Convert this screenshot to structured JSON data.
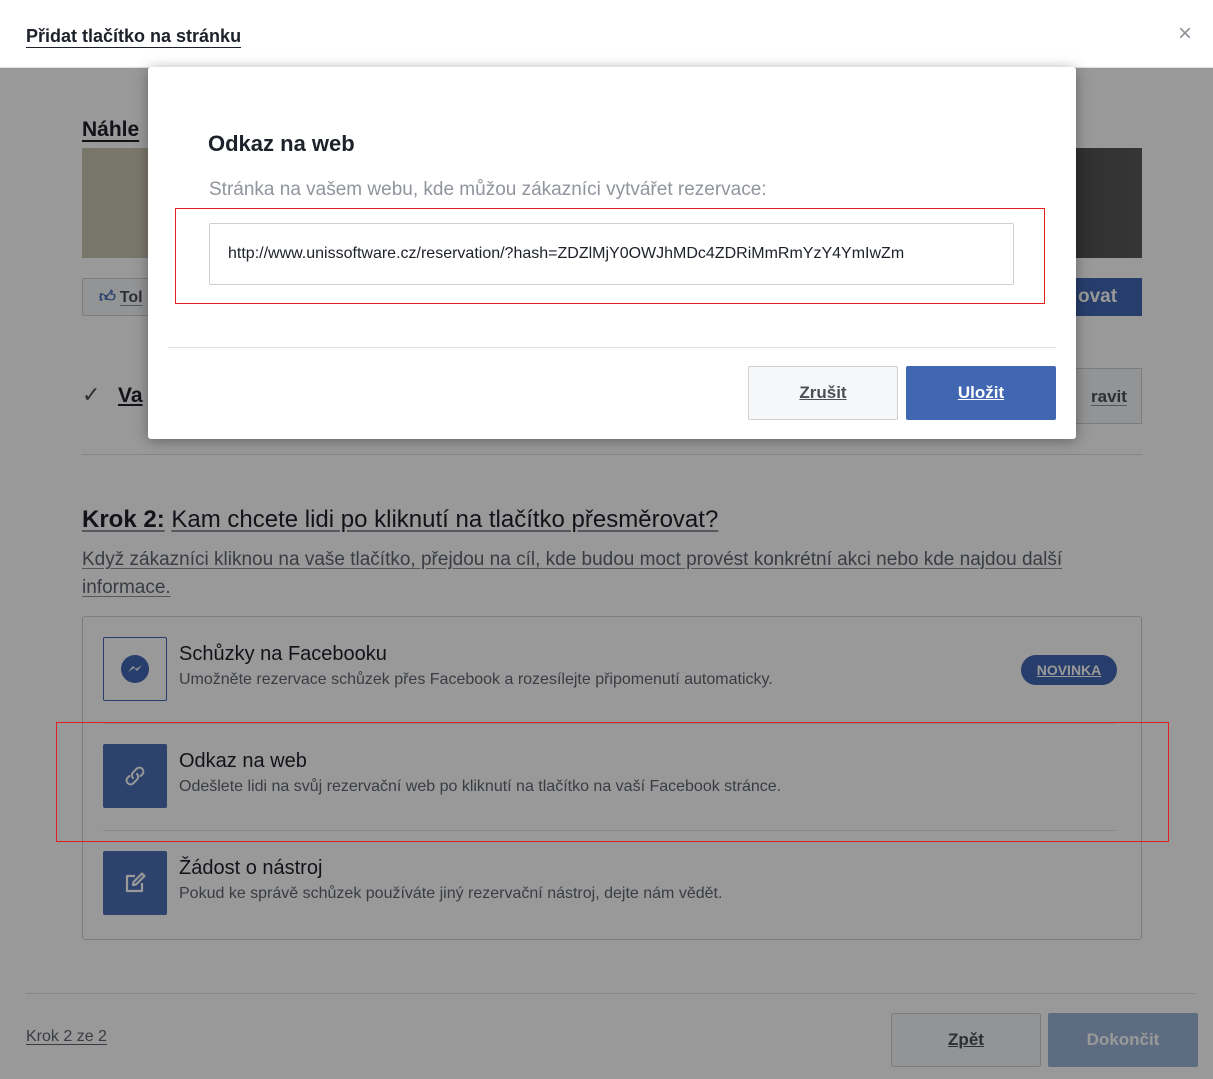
{
  "dialog": {
    "title": "Přidat tlačítko na stránku",
    "close_glyph": "×"
  },
  "preview": {
    "title": "Náhle",
    "like_label": "Tol",
    "cta_label": "ovat"
  },
  "step1": {
    "check_glyph": "✓",
    "text": "Va",
    "edit_label": "ravit"
  },
  "step2": {
    "prefix": "Krok 2:",
    "question": "Kam chcete lidi po kliknutí na tlačítko přesměrovat?",
    "description": "Když zákazníci kliknou na vaše tlačítko, přejdou na cíl, kde budou moct provést konkrétní akci nebo kde najdou další informace."
  },
  "options": [
    {
      "title": "Schůzky na Facebooku",
      "description": "Umožněte rezervace schůzek přes Facebook a rozesílejte připomenutí automaticky.",
      "badge": "NOVINKA",
      "icon": "messenger-icon"
    },
    {
      "title": "Odkaz na web",
      "description": "Odešlete lidi na svůj rezervační web po kliknutí na tlačítko na vaší Facebook stránce.",
      "icon": "link-icon"
    },
    {
      "title": "Žádost o nástroj",
      "description": "Pokud ke správě schůzek používáte jiný rezervační nástroj, dejte nám vědět.",
      "icon": "edit-icon"
    }
  ],
  "footer": {
    "step_counter": "Krok 2 ze 2",
    "back_label": "Zpět",
    "finish_label": "Dokončit"
  },
  "modal": {
    "title": "Odkaz na web",
    "label": "Stránka na vašem webu, kde můžou zákazníci vytvářet rezervace:",
    "url_value": "http://www.unissoftware.cz/reservation/?hash=ZDZlMjY0OWJhMDc4ZDRiMmRmYzY4YmIwZm",
    "cancel_label": "Zrušit",
    "save_label": "Uložit"
  },
  "colors": {
    "accent": "#4267b2",
    "highlight": "#e02020",
    "disabled": "#9cb4d8"
  }
}
